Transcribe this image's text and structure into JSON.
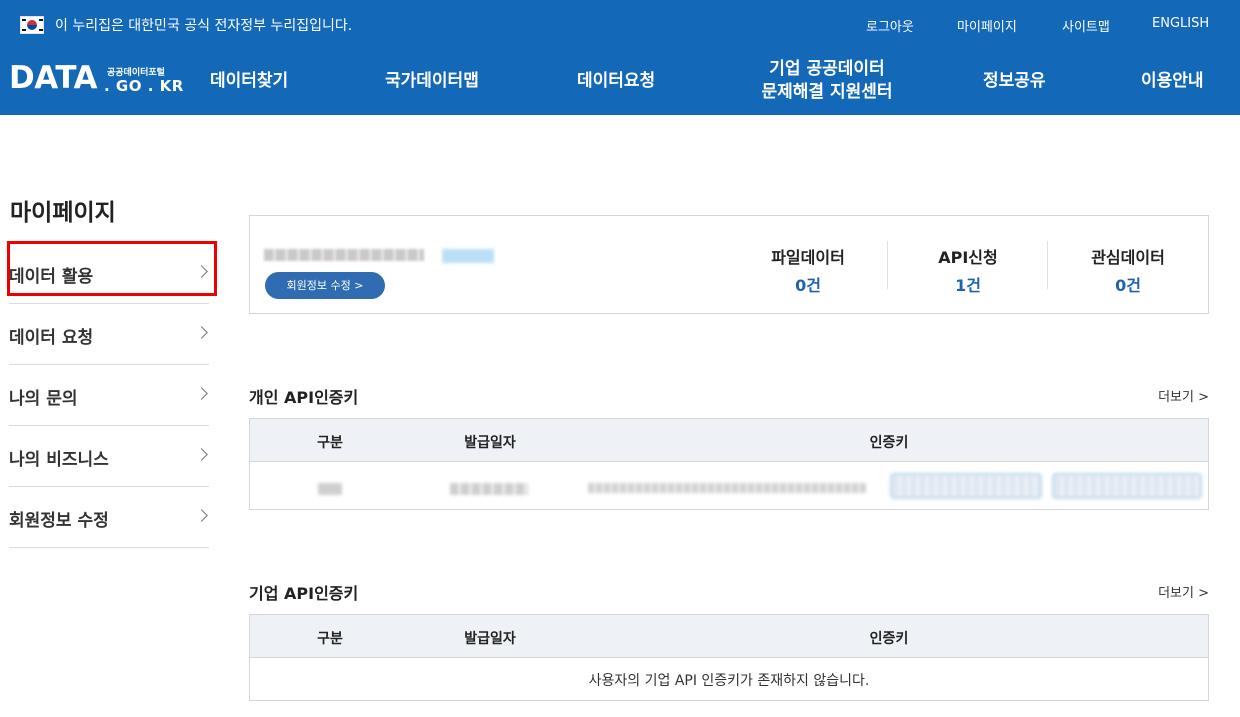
{
  "gov_banner": {
    "text": "이 누리집은 대한민국 공식 전자정부 누리집입니다."
  },
  "util_links": [
    "로그아웃",
    "마이페이지",
    "사이트맵",
    "ENGLISH"
  ],
  "logo": {
    "main": "DATA",
    "sub": "공공데이터포털",
    "domain": ". GO . KR"
  },
  "gnb": [
    {
      "line1": "데이터찾기",
      "line2": ""
    },
    {
      "line1": "국가데이터맵",
      "line2": ""
    },
    {
      "line1": "데이터요청",
      "line2": ""
    },
    {
      "line1": "기업 공공데이터",
      "line2": "문제해결 지원센터"
    },
    {
      "line1": "정보공유",
      "line2": ""
    },
    {
      "line1": "이용안내",
      "line2": ""
    }
  ],
  "sidebar": {
    "title": "마이페이지",
    "items": [
      "데이터 활용",
      "데이터 요청",
      "나의 문의",
      "나의 비즈니스",
      "회원정보 수정"
    ]
  },
  "summary": {
    "edit_button": "회원정보 수정 >",
    "stats": [
      {
        "label": "파일데이터",
        "value": "0건"
      },
      {
        "label": "API신청",
        "value": "1건"
      },
      {
        "label": "관심데이터",
        "value": "0건"
      }
    ]
  },
  "personal_keys": {
    "title": "개인 API인증키",
    "more": "더보기 >",
    "headers": [
      "구분",
      "발급일자",
      "인증키"
    ]
  },
  "business_keys": {
    "title": "기업 API인증키",
    "more": "더보기 >",
    "headers": [
      "구분",
      "발급일자",
      "인증키"
    ],
    "empty_message": "사용자의 기업 API 인증키가 존재하지 않습니다."
  },
  "colors": {
    "header_bg": "#1368b7",
    "accent": "#1f63b0",
    "highlight": "#ee0000"
  }
}
